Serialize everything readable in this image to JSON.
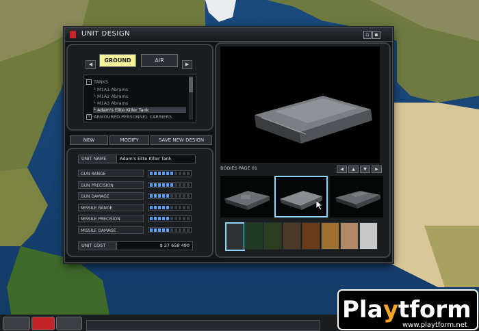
{
  "window": {
    "title": "UNIT DESIGN",
    "minimize_icon": "minimize-icon",
    "close_icon": "close-icon"
  },
  "categories": {
    "selected": "GROUND",
    "ground_label": "GROUND",
    "air_label": "AIR",
    "prev_arrow": "◀",
    "next_arrow": "▶"
  },
  "tree": {
    "group_tanks": "TANKS",
    "items": [
      "M1A1 Abrams",
      "M1A2 Abrams",
      "M1A3 Abrams",
      "Adam's Elite Killer Tank"
    ],
    "selected_item": "Adam's Elite Killer Tank",
    "group_apc": "ARMOURED PERSONNEL CARRIERS",
    "collapse_symbol": "−",
    "expand_symbol": "+"
  },
  "actions": {
    "new": "NEW",
    "modify": "MODIFY",
    "save_new": "SAVE NEW DESIGN"
  },
  "unit": {
    "name_label": "UNIT NAME",
    "name_value": "Adam's Elite Killer Tank",
    "cost_label": "UNIT COST",
    "cost_value": "$ 27 658 490"
  },
  "stats": [
    {
      "label": "GUN RANGE",
      "level": 6,
      "max": 10
    },
    {
      "label": "GUN PRECISION",
      "level": 6,
      "max": 10
    },
    {
      "label": "GUN DAMAGE",
      "level": 5,
      "max": 10
    },
    {
      "label": "MISSILE RANGE",
      "level": 5,
      "max": 10
    },
    {
      "label": "MISSILE PRECISION",
      "level": 5,
      "max": 10
    },
    {
      "label": "MISSILE DAMAGE",
      "level": 5,
      "max": 10
    }
  ],
  "bodies": {
    "label": "BODIES PAGE 01",
    "selected_index": 1,
    "count": 3
  },
  "colors": {
    "accent_red": "#c4252b",
    "stat_fill": "#5aa0ff",
    "button_highlight": "#f5f49a",
    "selection_outline": "#8fd3ff"
  },
  "swatches": [
    "#2e3234",
    "#1f3b22",
    "#2b3d1f",
    "#4a3a24",
    "#6b3a18",
    "#a07030",
    "#b08a64",
    "#c8c8c8"
  ],
  "watermark": {
    "brand": "Playtform",
    "url": "www.playtform.net"
  }
}
